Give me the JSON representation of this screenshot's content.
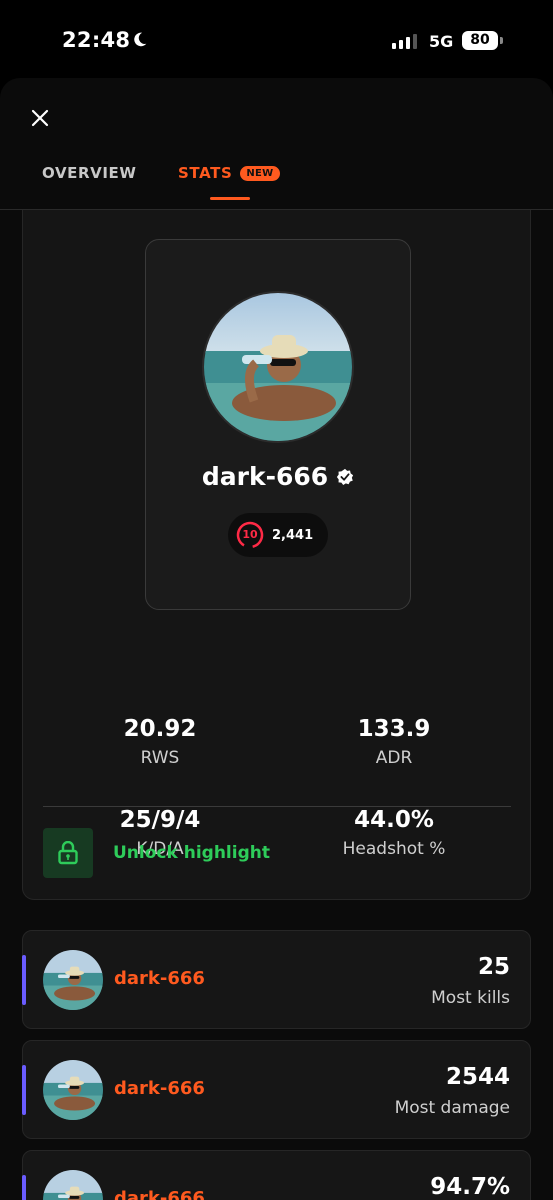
{
  "status_bar": {
    "time": "22:48",
    "network": "5G",
    "battery": "80"
  },
  "tabs": [
    {
      "label": "OVERVIEW"
    },
    {
      "label": "STATS",
      "badge": "NEW"
    }
  ],
  "player": {
    "name": "dark-666",
    "level": "10",
    "elo": "2,441"
  },
  "stats": {
    "rws": {
      "value": "20.92",
      "label": "RWS"
    },
    "adr": {
      "value": "133.9",
      "label": "ADR"
    },
    "kda": {
      "value": "25/9/4",
      "label": "K/D/A"
    },
    "headshot": {
      "value": "44.0%",
      "label": "Headshot %"
    }
  },
  "unlock": {
    "label": "Unlock highlight"
  },
  "highlights": [
    {
      "name": "dark-666",
      "value": "25",
      "label": "Most kills"
    },
    {
      "name": "dark-666",
      "value": "2544",
      "label": "Most damage"
    },
    {
      "name": "dark-666",
      "value": "94.7%",
      "label": ""
    }
  ],
  "colors": {
    "accent": "#ff5a1f",
    "unlock_green": "#2ecc5a",
    "level_red": "#ff2a46",
    "row_accent": "#6a5cff"
  },
  "icons": {
    "close": "close-icon",
    "verified": "verified-icon",
    "lock": "lock-icon",
    "moon": "moon-icon"
  }
}
